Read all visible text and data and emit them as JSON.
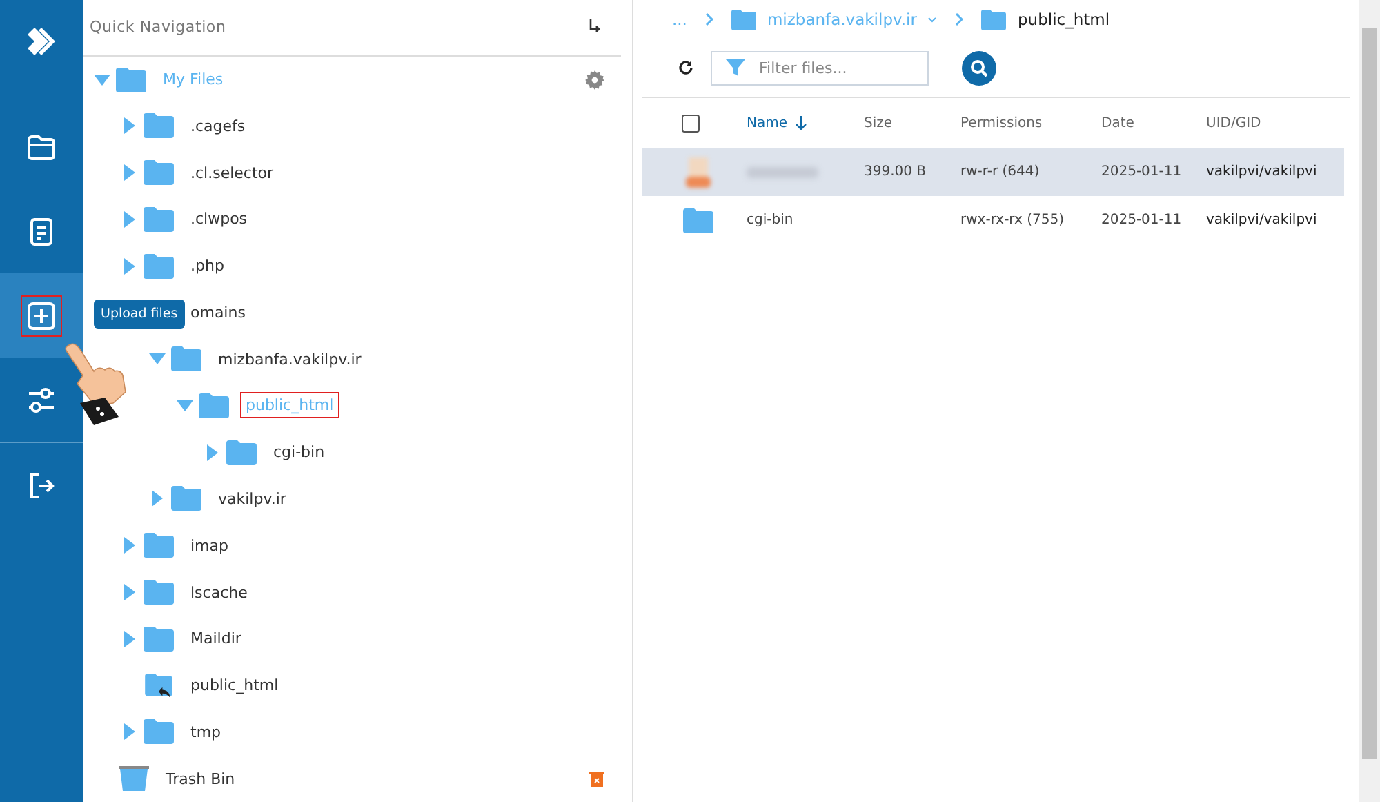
{
  "rail": {
    "items": [
      {
        "kind": "logo",
        "selected": false,
        "highlighted": false
      },
      {
        "kind": "folder",
        "selected": false,
        "highlighted": false
      },
      {
        "kind": "document",
        "selected": false,
        "highlighted": false
      },
      {
        "kind": "upload",
        "selected": true,
        "highlighted": true
      },
      {
        "kind": "settings",
        "selected": false,
        "highlighted": false
      },
      {
        "kind": "logout",
        "selected": false,
        "highlighted": false
      }
    ]
  },
  "tooltip": {
    "text": "Upload files"
  },
  "quick_navigation": {
    "title": "Quick Navigation"
  },
  "tree": {
    "label": "My Files",
    "kind": "folder",
    "expanded": true,
    "selected": true,
    "highlighted": false,
    "children": [
      {
        "label": ".cagefs",
        "kind": "folder",
        "expanded": false,
        "selected": false,
        "highlighted": false
      },
      {
        "label": ".cl.selector",
        "kind": "folder",
        "expanded": false,
        "selected": false,
        "highlighted": false
      },
      {
        "label": ".clwpos",
        "kind": "folder",
        "expanded": false,
        "selected": false,
        "highlighted": false
      },
      {
        "label": ".php",
        "kind": "folder",
        "expanded": false,
        "selected": false,
        "highlighted": false
      },
      {
        "label": "omains",
        "kind": "obscured",
        "selected": false,
        "highlighted": false,
        "children": [
          {
            "label": "mizbanfa.vakilpv.ir",
            "kind": "folder",
            "expanded": true,
            "selected": false,
            "highlighted": false,
            "children": [
              {
                "label": "public_html",
                "kind": "folder",
                "expanded": true,
                "selected": true,
                "highlighted": true,
                "children": [
                  {
                    "label": "cgi-bin",
                    "kind": "folder",
                    "expanded": false,
                    "selected": false,
                    "highlighted": false
                  }
                ]
              }
            ]
          },
          {
            "label": "vakilpv.ir",
            "kind": "folder",
            "expanded": false,
            "selected": false,
            "highlighted": false
          }
        ]
      },
      {
        "label": "imap",
        "kind": "folder",
        "expanded": false,
        "selected": false,
        "highlighted": false
      },
      {
        "label": "lscache",
        "kind": "folder",
        "expanded": false,
        "selected": false,
        "highlighted": false
      },
      {
        "label": "Maildir",
        "kind": "folder",
        "expanded": false,
        "selected": false,
        "highlighted": false
      },
      {
        "label": "public_html",
        "kind": "symlink",
        "selected": false,
        "highlighted": false
      },
      {
        "label": "tmp",
        "kind": "folder",
        "expanded": false,
        "selected": false,
        "highlighted": false
      }
    ]
  },
  "trash": {
    "label": "Trash Bin"
  },
  "breadcrumb": [
    {
      "label": "...",
      "kind": "ellipsis"
    },
    {
      "label": "mizbanfa.vakilpv.ir",
      "kind": "dropdown"
    },
    {
      "label": "public_html",
      "kind": "current"
    }
  ],
  "filter": {
    "placeholder": "Filter files..."
  },
  "table": {
    "select_all": {
      "checked": false
    },
    "columns": [
      {
        "label": "Name",
        "sorted": true
      },
      {
        "label": "Size",
        "sorted": false
      },
      {
        "label": "Permissions",
        "sorted": false
      },
      {
        "label": "Date",
        "sorted": false
      },
      {
        "label": "UID/GID",
        "sorted": false
      }
    ],
    "rows": [
      {
        "kind": "redacted",
        "selected": true,
        "size": "399.00 B",
        "permissions": "rw-r-r (644)",
        "date": "2025-01-11",
        "owner": "vakilpvi/vakilpvi"
      },
      {
        "kind": "folder",
        "selected": false,
        "name": "cgi-bin",
        "permissions": "rwx-rx-rx (755)",
        "date": "2025-01-11",
        "owner": "vakilpvi/vakilpvi"
      }
    ]
  }
}
